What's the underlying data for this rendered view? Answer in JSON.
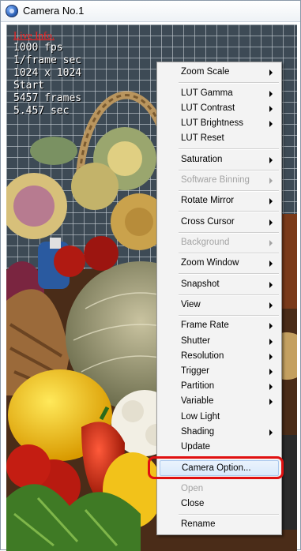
{
  "window": {
    "title": "Camera No.1"
  },
  "live_info": {
    "header": "Live Info.",
    "lines": [
      "1000 fps",
      "1/frame sec",
      "1024 x 1024",
      "Start",
      "5457 frames",
      "5.457 sec"
    ]
  },
  "menu": {
    "items": [
      {
        "label": "Zoom Scale",
        "submenu": true,
        "disabled": false
      },
      {
        "label": "LUT Gamma",
        "submenu": true,
        "disabled": false
      },
      {
        "label": "LUT Contrast",
        "submenu": true,
        "disabled": false
      },
      {
        "label": "LUT Brightness",
        "submenu": true,
        "disabled": false
      },
      {
        "label": "LUT Reset",
        "submenu": false,
        "disabled": false
      },
      {
        "label": "Saturation",
        "submenu": true,
        "disabled": false
      },
      {
        "label": "Software Binning",
        "submenu": true,
        "disabled": true
      },
      {
        "label": "Rotate  Mirror",
        "submenu": true,
        "disabled": false
      },
      {
        "label": "Cross Cursor",
        "submenu": true,
        "disabled": false
      },
      {
        "label": "Background",
        "submenu": true,
        "disabled": true
      },
      {
        "label": "Zoom Window",
        "submenu": true,
        "disabled": false
      },
      {
        "label": "Snapshot",
        "submenu": true,
        "disabled": false
      },
      {
        "label": "View",
        "submenu": true,
        "disabled": false
      },
      {
        "label": "Frame Rate",
        "submenu": true,
        "disabled": false
      },
      {
        "label": "Shutter",
        "submenu": true,
        "disabled": false
      },
      {
        "label": "Resolution",
        "submenu": true,
        "disabled": false
      },
      {
        "label": "Trigger",
        "submenu": true,
        "disabled": false
      },
      {
        "label": "Partition",
        "submenu": true,
        "disabled": false
      },
      {
        "label": "Variable",
        "submenu": true,
        "disabled": false
      },
      {
        "label": "Low Light",
        "submenu": false,
        "disabled": false
      },
      {
        "label": "Shading",
        "submenu": true,
        "disabled": false
      },
      {
        "label": "Update",
        "submenu": false,
        "disabled": false
      },
      {
        "label": "Camera Option...",
        "submenu": false,
        "disabled": false,
        "highlighted": true
      },
      {
        "label": "Open",
        "submenu": false,
        "disabled": true
      },
      {
        "label": "Close",
        "submenu": false,
        "disabled": false
      },
      {
        "label": "Rename",
        "submenu": false,
        "disabled": false
      }
    ]
  },
  "colors": {
    "live_info_header": "#ff2020",
    "highlight_outline": "#e01010",
    "menu_background": "#f3f3f3",
    "disabled_text": "#a3a3a3"
  }
}
